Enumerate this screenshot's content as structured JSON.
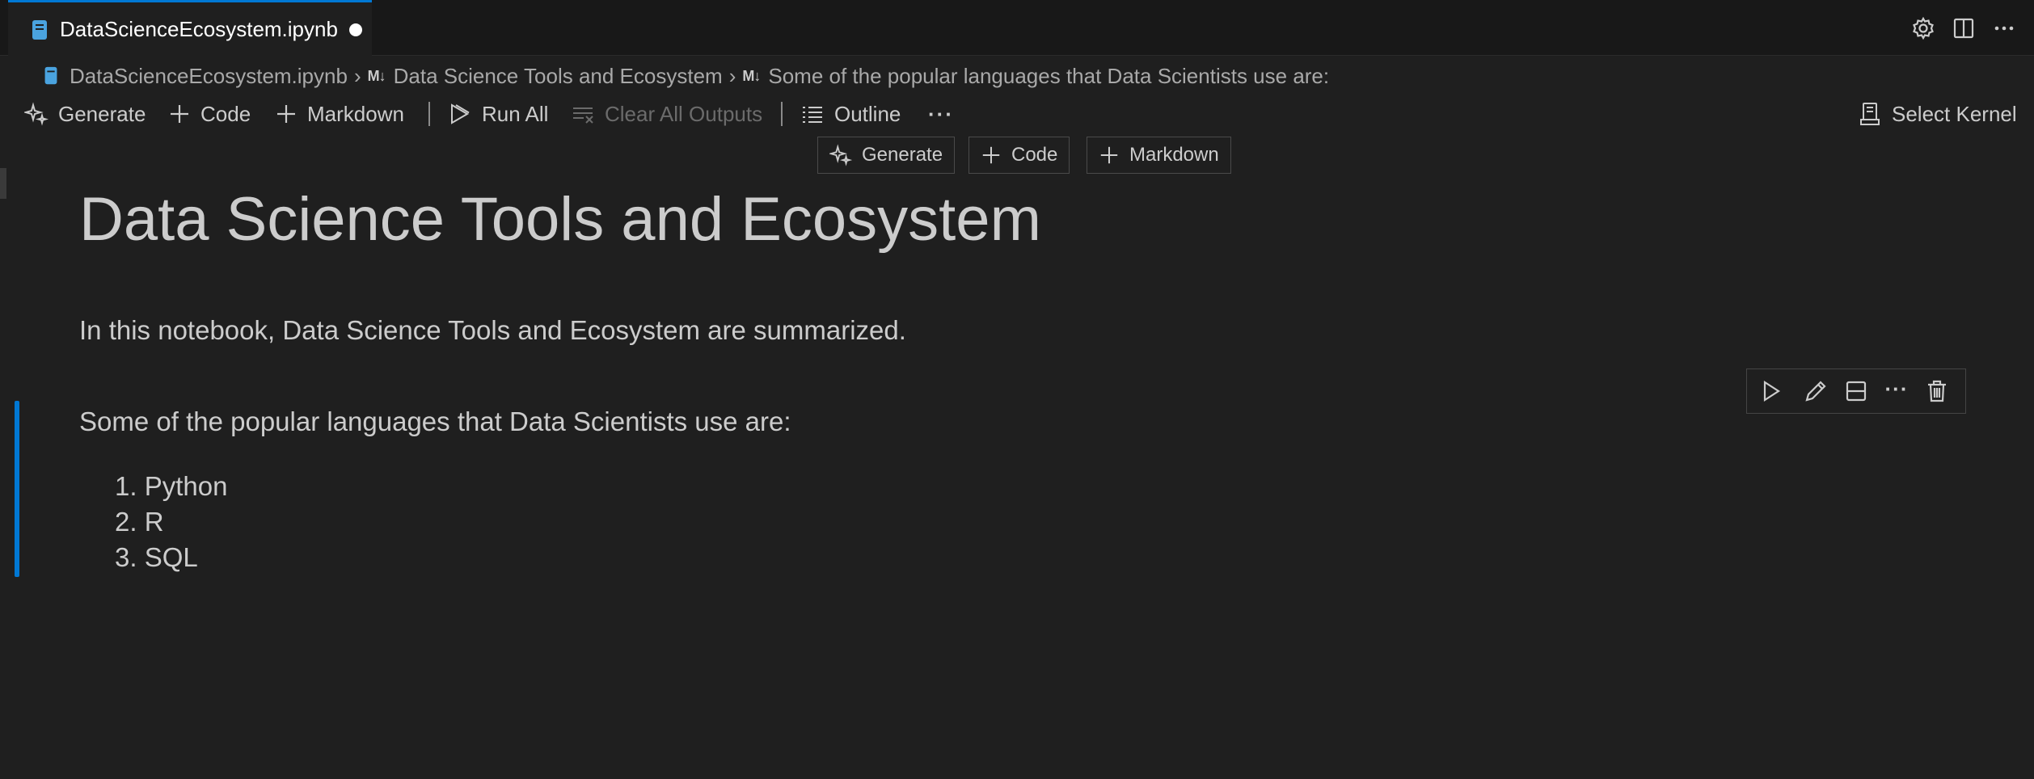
{
  "tab": {
    "filename": "DataScienceEcosystem.ipynb",
    "dirty": true
  },
  "breadcrumb": {
    "file": "DataScienceEcosystem.ipynb",
    "section1_badge": "M↓",
    "section1": "Data Science Tools and Ecosystem",
    "section2_badge": "M↓",
    "section2": "Some of the popular languages that Data Scientists use are:"
  },
  "toolbar": {
    "generate": "Generate",
    "code": "Code",
    "markdown": "Markdown",
    "run_all": "Run All",
    "clear_outputs": "Clear All Outputs",
    "outline": "Outline",
    "more": "···",
    "select_kernel": "Select Kernel"
  },
  "insert": {
    "generate": "Generate",
    "code": "Code",
    "markdown": "Markdown"
  },
  "cells": {
    "heading": "Data Science Tools and Ecosystem",
    "intro": "In this notebook, Data Science Tools and Ecosystem are summarized.",
    "languages_intro": "Some of the popular languages that Data Scientists use are:",
    "languages": [
      "1. Python",
      "2. R",
      "3. SQL"
    ]
  },
  "cell_toolbar": {
    "more": "···"
  },
  "icons": {
    "tab": [
      "notebook-file-icon"
    ],
    "actions": [
      "settings-gear-icon",
      "split-editor-icon",
      "more-actions-icon"
    ],
    "toolbar": [
      "sparkle-icon",
      "plus-icon",
      "plus-icon",
      "run-all-icon",
      "clear-outputs-icon",
      "outline-list-icon",
      "kernel-icon"
    ],
    "cell": [
      "execute-cell-icon",
      "edit-pencil-icon",
      "split-cell-icon",
      "more-icon",
      "delete-trash-icon"
    ]
  },
  "colors": {
    "accent": "#0078d4",
    "background": "#1f1f1f",
    "tabbar": "#181818",
    "text": "#cccccc"
  }
}
